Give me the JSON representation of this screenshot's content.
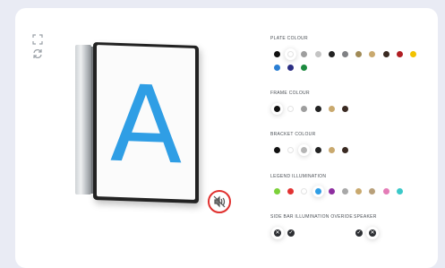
{
  "tools": {
    "expand_icon": "expand-icon",
    "rotate_icon": "rotate-icon"
  },
  "sign": {
    "legend_text": "A",
    "legend_color": "#2f9ee5",
    "mute_icon": "speaker-muted-icon"
  },
  "plate_colour": {
    "title": "PLATE COLOUR",
    "selected": "#ffffff",
    "swatches": [
      "#111111",
      "#ffffff",
      "#9e9e9e",
      "#c4c4c4",
      "#222222",
      "#808184",
      "#a08a56",
      "#c9a96e",
      "#3a2a22",
      "#b01e23",
      "#f2c200",
      "#2a7fd4",
      "#2b2e83",
      "#1c8a3f"
    ]
  },
  "frame_colour": {
    "title": "FRAME COLOUR",
    "selected": "#111111",
    "swatches": [
      "#111111",
      "#ffffff",
      "#9e9e9e",
      "#222222",
      "#c9a96e",
      "#3a2a22"
    ]
  },
  "bracket_colour": {
    "title": "BRACKET COLOUR",
    "selected": "#b5b5b5",
    "swatches": [
      "#111111",
      "#ffffff",
      "#b5b5b5",
      "#222222",
      "#c9a96e",
      "#3a2a22"
    ]
  },
  "legend_illumination": {
    "title": "LEGEND ILLUMINATION",
    "selected": "#2f9ee5",
    "swatches": [
      "#7cd13a",
      "#e23232",
      "#ffffff",
      "#2f9ee5",
      "#8e2ea0",
      "#a8a8a8",
      "#c9a96e",
      "#b8a07a",
      "#e47cb7",
      "#3bc9c9"
    ]
  },
  "side_bar_illumination": {
    "title": "SIDE BAR ILLUMINATION OVERIDE",
    "off_icon": "close-icon",
    "on_icon": "check-icon"
  },
  "speaker": {
    "title": "SPEAKER",
    "on_icon": "check-icon",
    "off_icon": "close-icon"
  }
}
